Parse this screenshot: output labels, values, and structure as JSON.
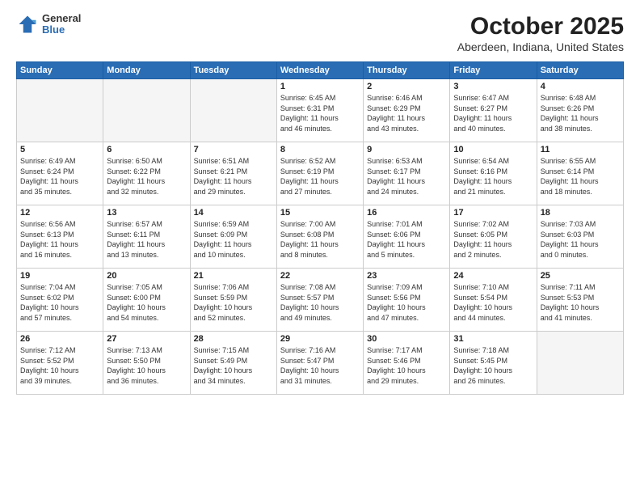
{
  "header": {
    "logo": {
      "general": "General",
      "blue": "Blue"
    },
    "title": "October 2025",
    "location": "Aberdeen, Indiana, United States"
  },
  "weekdays": [
    "Sunday",
    "Monday",
    "Tuesday",
    "Wednesday",
    "Thursday",
    "Friday",
    "Saturday"
  ],
  "weeks": [
    [
      {
        "day": "",
        "info": ""
      },
      {
        "day": "",
        "info": ""
      },
      {
        "day": "",
        "info": ""
      },
      {
        "day": "1",
        "info": "Sunrise: 6:45 AM\nSunset: 6:31 PM\nDaylight: 11 hours\nand 46 minutes."
      },
      {
        "day": "2",
        "info": "Sunrise: 6:46 AM\nSunset: 6:29 PM\nDaylight: 11 hours\nand 43 minutes."
      },
      {
        "day": "3",
        "info": "Sunrise: 6:47 AM\nSunset: 6:27 PM\nDaylight: 11 hours\nand 40 minutes."
      },
      {
        "day": "4",
        "info": "Sunrise: 6:48 AM\nSunset: 6:26 PM\nDaylight: 11 hours\nand 38 minutes."
      }
    ],
    [
      {
        "day": "5",
        "info": "Sunrise: 6:49 AM\nSunset: 6:24 PM\nDaylight: 11 hours\nand 35 minutes."
      },
      {
        "day": "6",
        "info": "Sunrise: 6:50 AM\nSunset: 6:22 PM\nDaylight: 11 hours\nand 32 minutes."
      },
      {
        "day": "7",
        "info": "Sunrise: 6:51 AM\nSunset: 6:21 PM\nDaylight: 11 hours\nand 29 minutes."
      },
      {
        "day": "8",
        "info": "Sunrise: 6:52 AM\nSunset: 6:19 PM\nDaylight: 11 hours\nand 27 minutes."
      },
      {
        "day": "9",
        "info": "Sunrise: 6:53 AM\nSunset: 6:17 PM\nDaylight: 11 hours\nand 24 minutes."
      },
      {
        "day": "10",
        "info": "Sunrise: 6:54 AM\nSunset: 6:16 PM\nDaylight: 11 hours\nand 21 minutes."
      },
      {
        "day": "11",
        "info": "Sunrise: 6:55 AM\nSunset: 6:14 PM\nDaylight: 11 hours\nand 18 minutes."
      }
    ],
    [
      {
        "day": "12",
        "info": "Sunrise: 6:56 AM\nSunset: 6:13 PM\nDaylight: 11 hours\nand 16 minutes."
      },
      {
        "day": "13",
        "info": "Sunrise: 6:57 AM\nSunset: 6:11 PM\nDaylight: 11 hours\nand 13 minutes."
      },
      {
        "day": "14",
        "info": "Sunrise: 6:59 AM\nSunset: 6:09 PM\nDaylight: 11 hours\nand 10 minutes."
      },
      {
        "day": "15",
        "info": "Sunrise: 7:00 AM\nSunset: 6:08 PM\nDaylight: 11 hours\nand 8 minutes."
      },
      {
        "day": "16",
        "info": "Sunrise: 7:01 AM\nSunset: 6:06 PM\nDaylight: 11 hours\nand 5 minutes."
      },
      {
        "day": "17",
        "info": "Sunrise: 7:02 AM\nSunset: 6:05 PM\nDaylight: 11 hours\nand 2 minutes."
      },
      {
        "day": "18",
        "info": "Sunrise: 7:03 AM\nSunset: 6:03 PM\nDaylight: 11 hours\nand 0 minutes."
      }
    ],
    [
      {
        "day": "19",
        "info": "Sunrise: 7:04 AM\nSunset: 6:02 PM\nDaylight: 10 hours\nand 57 minutes."
      },
      {
        "day": "20",
        "info": "Sunrise: 7:05 AM\nSunset: 6:00 PM\nDaylight: 10 hours\nand 54 minutes."
      },
      {
        "day": "21",
        "info": "Sunrise: 7:06 AM\nSunset: 5:59 PM\nDaylight: 10 hours\nand 52 minutes."
      },
      {
        "day": "22",
        "info": "Sunrise: 7:08 AM\nSunset: 5:57 PM\nDaylight: 10 hours\nand 49 minutes."
      },
      {
        "day": "23",
        "info": "Sunrise: 7:09 AM\nSunset: 5:56 PM\nDaylight: 10 hours\nand 47 minutes."
      },
      {
        "day": "24",
        "info": "Sunrise: 7:10 AM\nSunset: 5:54 PM\nDaylight: 10 hours\nand 44 minutes."
      },
      {
        "day": "25",
        "info": "Sunrise: 7:11 AM\nSunset: 5:53 PM\nDaylight: 10 hours\nand 41 minutes."
      }
    ],
    [
      {
        "day": "26",
        "info": "Sunrise: 7:12 AM\nSunset: 5:52 PM\nDaylight: 10 hours\nand 39 minutes."
      },
      {
        "day": "27",
        "info": "Sunrise: 7:13 AM\nSunset: 5:50 PM\nDaylight: 10 hours\nand 36 minutes."
      },
      {
        "day": "28",
        "info": "Sunrise: 7:15 AM\nSunset: 5:49 PM\nDaylight: 10 hours\nand 34 minutes."
      },
      {
        "day": "29",
        "info": "Sunrise: 7:16 AM\nSunset: 5:47 PM\nDaylight: 10 hours\nand 31 minutes."
      },
      {
        "day": "30",
        "info": "Sunrise: 7:17 AM\nSunset: 5:46 PM\nDaylight: 10 hours\nand 29 minutes."
      },
      {
        "day": "31",
        "info": "Sunrise: 7:18 AM\nSunset: 5:45 PM\nDaylight: 10 hours\nand 26 minutes."
      },
      {
        "day": "",
        "info": ""
      }
    ]
  ]
}
